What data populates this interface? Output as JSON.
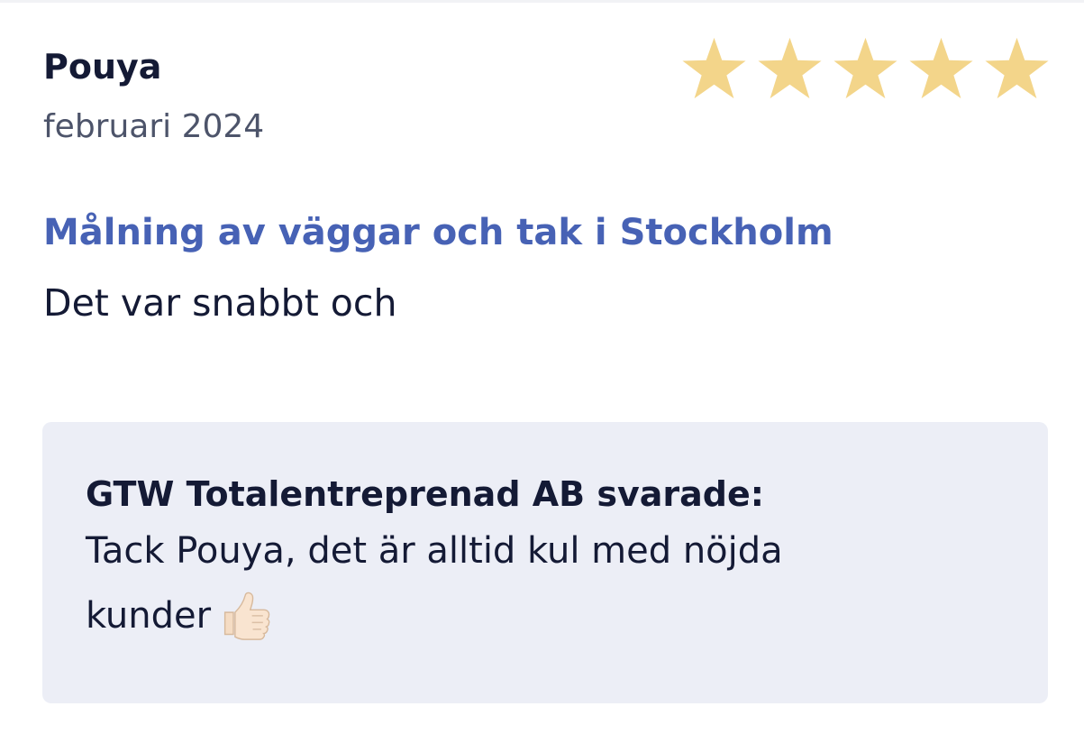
{
  "review": {
    "reviewer_name": "Pouya",
    "date": "februari 2024",
    "rating": 5,
    "rating_max": 5,
    "star_color": "#f3d58a",
    "service_title": "Målning av väggar och tak i Stockholm",
    "text": "Det var snabbt och"
  },
  "reply": {
    "heading": "GTW Totalentreprenad AB svarade:",
    "text": "Tack Pouya, det är alltid kul med nöjda kunder",
    "icon": "thumbs-up-icon"
  },
  "colors": {
    "link": "#4762b5",
    "reply_background": "#eceef6",
    "text_dark": "#141a35",
    "text_muted": "#4d546a"
  }
}
